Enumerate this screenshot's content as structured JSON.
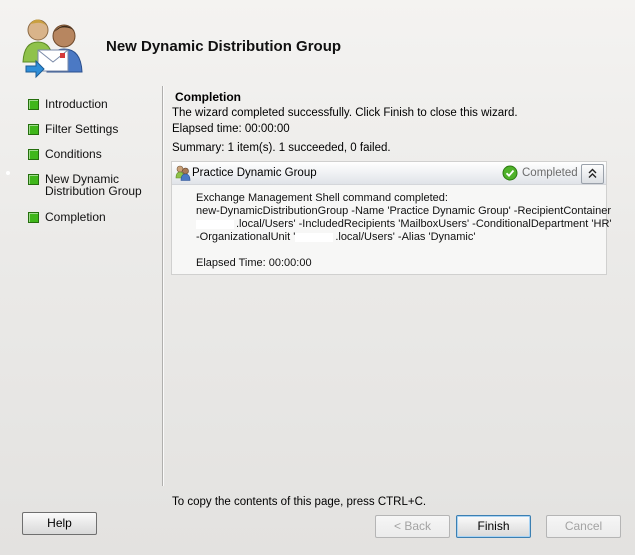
{
  "wizard": {
    "title": "New Dynamic Distribution Group"
  },
  "nav": {
    "items": [
      {
        "label": "Introduction"
      },
      {
        "label": "Filter Settings"
      },
      {
        "label": "Conditions"
      },
      {
        "label": "New Dynamic\nDistribution Group"
      },
      {
        "label": "Completion"
      }
    ]
  },
  "completion": {
    "heading": "Completion",
    "message": "The wizard completed successfully. Click Finish to close this wizard.",
    "elapsed": "Elapsed time: 00:00:00",
    "summary": "Summary: 1 item(s). 1 succeeded, 0 failed."
  },
  "result": {
    "title": "Practice Dynamic Group",
    "status": "Completed",
    "status_color": "#3a9a1a",
    "icons": {
      "item": "users-icon",
      "status": "green-check-icon",
      "toggle": "double-chevron-up-icon"
    },
    "body": {
      "line1": "Exchange Management Shell command completed:",
      "line2": "new-DynamicDistributionGroup -Name 'Practice Dynamic Group' -RecipientContainer",
      "line3": ".local/Users' -IncludedRecipients 'MailboxUsers' -ConditionalDepartment 'HR'",
      "line4a": "-OrganizationalUnit '",
      "line4b": ".local/Users' -Alias 'Dynamic'",
      "elapsed": "Elapsed Time: 00:00:00"
    }
  },
  "footer": {
    "copy_hint": "To copy the contents of this page, press CTRL+C.",
    "help": "Help",
    "back": "< Back",
    "finish": "Finish",
    "cancel": "Cancel"
  },
  "colors": {
    "nav_square": "#3fb61a",
    "accent_blue": "#3c7fb1"
  }
}
